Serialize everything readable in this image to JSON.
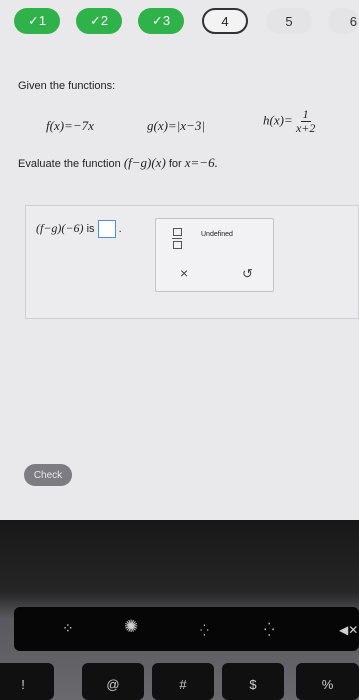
{
  "steps": [
    {
      "label": "✓1",
      "state": "done"
    },
    {
      "label": "✓2",
      "state": "done"
    },
    {
      "label": "✓3",
      "state": "done"
    },
    {
      "label": "4",
      "state": "current"
    },
    {
      "label": "5",
      "state": "todo"
    },
    {
      "label": "6",
      "state": "todo"
    }
  ],
  "question": {
    "intro": "Given the functions:",
    "f": "f(x)=−7x",
    "g": "g(x)=|x−3|",
    "h_left": "h(x)=",
    "h_num": "1",
    "h_den": "x+2",
    "prompt_text": "Evaluate the function",
    "prompt_expr": "(f−g)(x)",
    "prompt_for": "for",
    "prompt_value": "x=−6."
  },
  "answer": {
    "expr": "(f−g)(−6)",
    "is": "is",
    "period": "."
  },
  "keypad": {
    "undefined_label": "Undefined",
    "clear_symbol": "×",
    "undo_symbol": "↺"
  },
  "check_label": "Check",
  "keyboard": {
    "touchbar_icons": [
      "brightness-low-icon",
      "brightness-high-icon",
      "keyboard-light-low-icon",
      "keyboard-light-high-icon",
      "mute-icon"
    ],
    "keys": [
      "!",
      "@",
      "#",
      "$",
      "%"
    ]
  }
}
